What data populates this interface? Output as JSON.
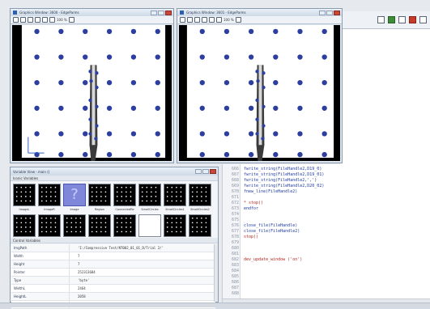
{
  "graphics_windows": [
    {
      "title": "Graphics Window: 3600 - EdgeParms",
      "zoom_label": "100 %"
    },
    {
      "title": "Graphics Window: 3601 - EdgeParms",
      "zoom_label": "100 %"
    }
  ],
  "variable_view": {
    "title": "Variable View - main ()",
    "iconic_section": "Iconic Variables",
    "control_section": "Control Variables",
    "iconic": [
      {
        "name": "ImageL",
        "style": "dots"
      },
      {
        "name": "ImageR",
        "style": "dots"
      },
      {
        "name": "Image",
        "style": "selected"
      },
      {
        "name": "Region",
        "style": "dots"
      },
      {
        "name": "ConnectedRe",
        "style": "dots"
      },
      {
        "name": "SmallCircles",
        "style": "dots"
      },
      {
        "name": "SmallCircles1",
        "style": "dots"
      },
      {
        "name": "SmallCircles2",
        "style": "dots"
      },
      {
        "name": "",
        "style": "dark"
      },
      {
        "name": "",
        "style": "dark"
      },
      {
        "name": "",
        "style": "dark"
      },
      {
        "name": "",
        "style": "dark"
      },
      {
        "name": "",
        "style": "dark"
      },
      {
        "name": "",
        "style": "white"
      },
      {
        "name": "",
        "style": "dark"
      },
      {
        "name": "",
        "style": "dark"
      }
    ],
    "control": [
      {
        "name": "ImgPath",
        "value": "'I:/Compressive Test/NT002_01_01_D/Trial 2/'"
      },
      {
        "name": "Width",
        "value": "7"
      },
      {
        "name": "Height",
        "value": "7"
      },
      {
        "name": "Pointer",
        "value": "252313684"
      },
      {
        "name": "Type",
        "value": "'byte'"
      },
      {
        "name": "WidthL",
        "value": "2464"
      },
      {
        "name": "HeightL",
        "value": "2058"
      },
      {
        "name": "PointerL",
        "value": "267423324"
      }
    ]
  },
  "editor": {
    "lines": [
      {
        "num": "666",
        "text": "fwrite_string(FileHandle2,D19_0)",
        "color": "blue"
      },
      {
        "num": "667",
        "text": "fwrite_string(FileHandle2,D19_01)",
        "color": "blue"
      },
      {
        "num": "668",
        "text": "fwrite_string(FileHandle2,',')",
        "color": "blue"
      },
      {
        "num": "669",
        "text": "fwrite_string(FileHandle2,D20_02)",
        "color": "blue"
      },
      {
        "num": "670",
        "text": "fnew_line(FileHandle2)",
        "color": "blue"
      },
      {
        "num": "671",
        "text": "",
        "color": "blue"
      },
      {
        "num": "672",
        "text": "* stop()",
        "color": "red"
      },
      {
        "num": "673",
        "text": "endfor",
        "color": "blue"
      },
      {
        "num": "674",
        "text": "",
        "color": "blue"
      },
      {
        "num": "675",
        "text": "",
        "color": "blue"
      },
      {
        "num": "676",
        "text": "close_file(FileHandle)",
        "color": "blue"
      },
      {
        "num": "677",
        "text": "close_file(FileHandle2)",
        "color": "blue"
      },
      {
        "num": "678",
        "text": "stop()",
        "color": "red"
      },
      {
        "num": "679",
        "text": "",
        "color": "blue"
      },
      {
        "num": "680",
        "text": "",
        "color": "blue"
      },
      {
        "num": "681",
        "text": "",
        "color": "blue"
      },
      {
        "num": "682",
        "text": "dev_update_window ('on')",
        "color": "red"
      },
      {
        "num": "683",
        "text": "",
        "color": "blue"
      },
      {
        "num": "684",
        "text": "",
        "color": "blue"
      },
      {
        "num": "685",
        "text": "",
        "color": "blue"
      },
      {
        "num": "686",
        "text": "",
        "color": "blue"
      },
      {
        "num": "687",
        "text": "",
        "color": "blue"
      },
      {
        "num": "688",
        "text": "",
        "color": "blue"
      }
    ]
  },
  "colors": {
    "dot": "#2d3f9e",
    "canvas": "#ffffff",
    "frame": "#000000"
  }
}
